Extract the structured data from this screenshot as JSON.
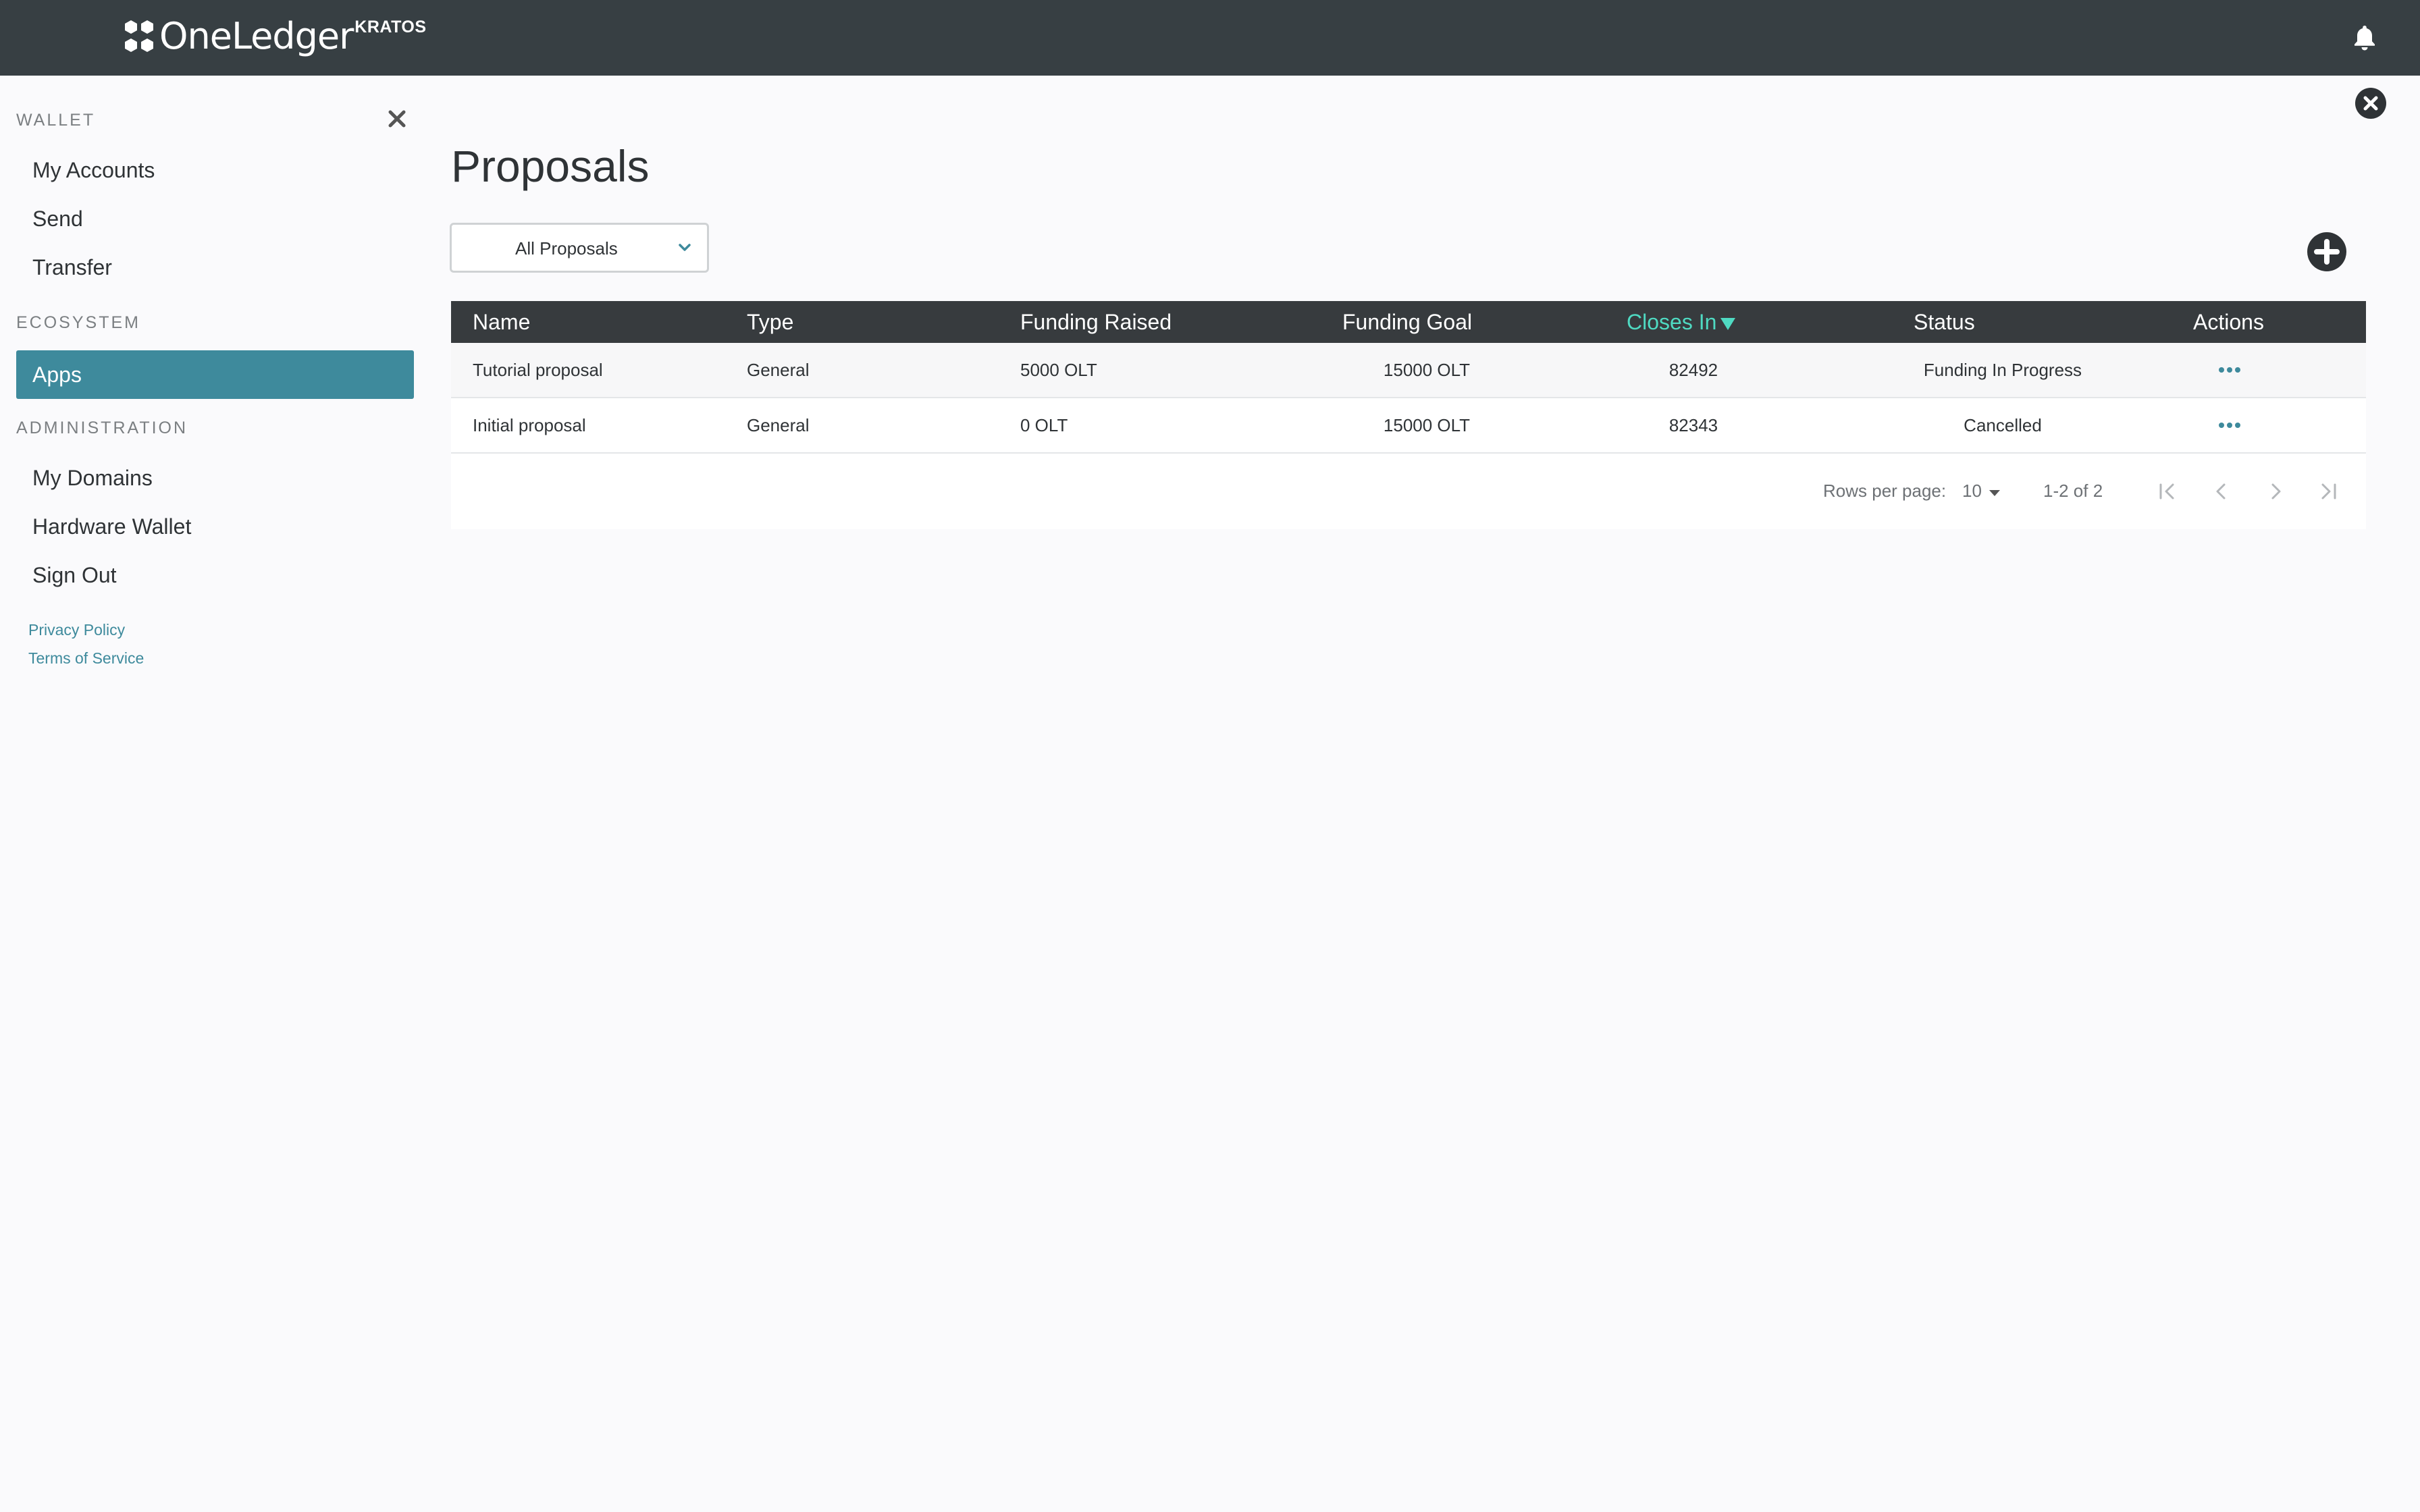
{
  "app": {
    "brand_name": "OneLedger",
    "brand_sup": "KRATOS"
  },
  "sidebar": {
    "sections": [
      {
        "title": "WALLET",
        "items": [
          {
            "label": "My Accounts"
          },
          {
            "label": "Send"
          },
          {
            "label": "Transfer"
          }
        ]
      },
      {
        "title": "ECOSYSTEM",
        "items": [
          {
            "label": "Apps",
            "active": true
          }
        ]
      },
      {
        "title": "ADMINISTRATION",
        "items": [
          {
            "label": "My Domains"
          },
          {
            "label": "Hardware Wallet"
          },
          {
            "label": "Sign Out"
          }
        ]
      }
    ],
    "links": [
      "Privacy Policy",
      "Terms of Service"
    ]
  },
  "main": {
    "title": "Proposals",
    "filter": {
      "value": "All Proposals"
    },
    "table": {
      "columns": [
        "Name",
        "Type",
        "Funding Raised",
        "Funding Goal",
        "Closes In",
        "Status",
        "Actions"
      ],
      "sorted_column": "Closes In",
      "rows": [
        {
          "name": "Tutorial proposal",
          "type": "General",
          "funding_raised": "5000 OLT",
          "funding_goal": "15000 OLT",
          "closes_in": "82492",
          "status": "Funding In Progress"
        },
        {
          "name": "Initial proposal",
          "type": "General",
          "funding_raised": "0 OLT",
          "funding_goal": "15000 OLT",
          "closes_in": "82343",
          "status": "Cancelled"
        }
      ]
    },
    "pagination": {
      "rows_per_page_label": "Rows per page:",
      "rows_per_page": "10",
      "range": "1-2 of 2"
    }
  },
  "colors": {
    "topbar": "#373f43",
    "accent": "#3e8a9c",
    "sorted_header": "#4fdac2"
  },
  "icons": [
    "logo-icon",
    "bell-icon",
    "close-icon",
    "close-circle-icon",
    "chevron-down-icon",
    "plus-circle-icon",
    "more-icon",
    "first-page-icon",
    "prev-page-icon",
    "next-page-icon",
    "last-page-icon"
  ]
}
